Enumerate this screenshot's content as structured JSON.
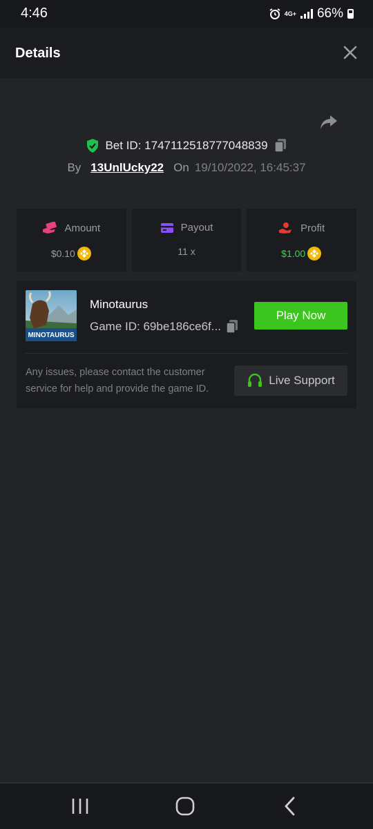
{
  "status_bar": {
    "time": "4:46",
    "network": "4G+",
    "battery": "66%"
  },
  "header": {
    "title": "Details"
  },
  "bet": {
    "label": "Bet ID: 1747112518777048839",
    "by_label": "By",
    "username": "13UnlUcky22",
    "on_label": "On",
    "datetime": "19/10/2022, 16:45:37"
  },
  "stats": [
    {
      "label": "Amount",
      "value": "$0.10",
      "icon": "cash-hand-icon",
      "color": "#e7417d"
    },
    {
      "label": "Payout",
      "value": "11 x",
      "icon": "card-icon",
      "color": "#8b4ff7"
    },
    {
      "label": "Profit",
      "value": "$1.00",
      "icon": "profit-hand-icon",
      "color": "#e53935"
    }
  ],
  "game": {
    "name": "Minotaurus",
    "id": "Game ID: 69be186ce6f...",
    "thumb_text": "MINOTAURUS",
    "play_label": "Play Now"
  },
  "support": {
    "help_text": "Any issues, please contact the customer service for help and provide the game ID.",
    "button_label": "Live Support"
  },
  "colors": {
    "accent_green": "#3cc41f",
    "profit_green": "#3fd14a",
    "coin_gold": "#f0b90b",
    "shield_green": "#1ec24a"
  }
}
